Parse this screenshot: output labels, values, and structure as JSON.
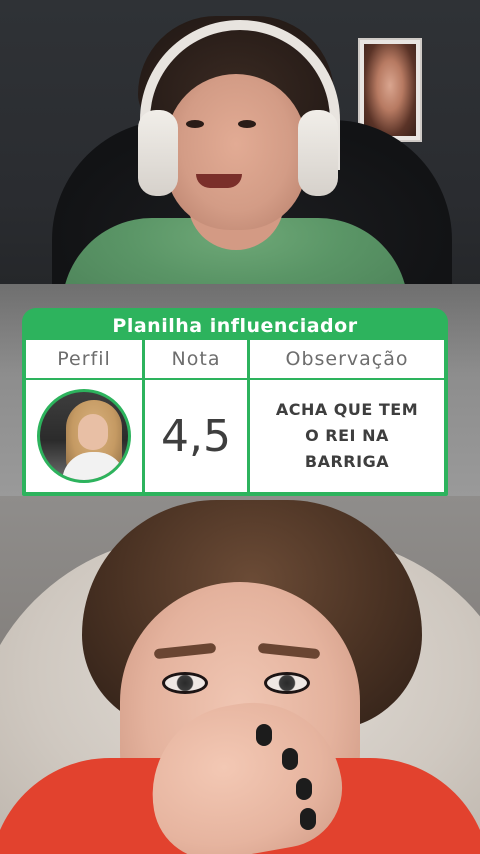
{
  "sheet": {
    "title": "Planilha influenciador",
    "columns": [
      "Perfil",
      "Nota",
      "Observação"
    ],
    "row": {
      "profile_icon": "profile-photo",
      "nota": "4,5",
      "observacao_lines": [
        "ACHA QUE TEM",
        "O REI NA",
        "BARRIGA"
      ]
    },
    "colors": {
      "accent": "#2db35d",
      "header_text": "#6d6d6d",
      "cell_text": "#3e3e3e"
    }
  }
}
